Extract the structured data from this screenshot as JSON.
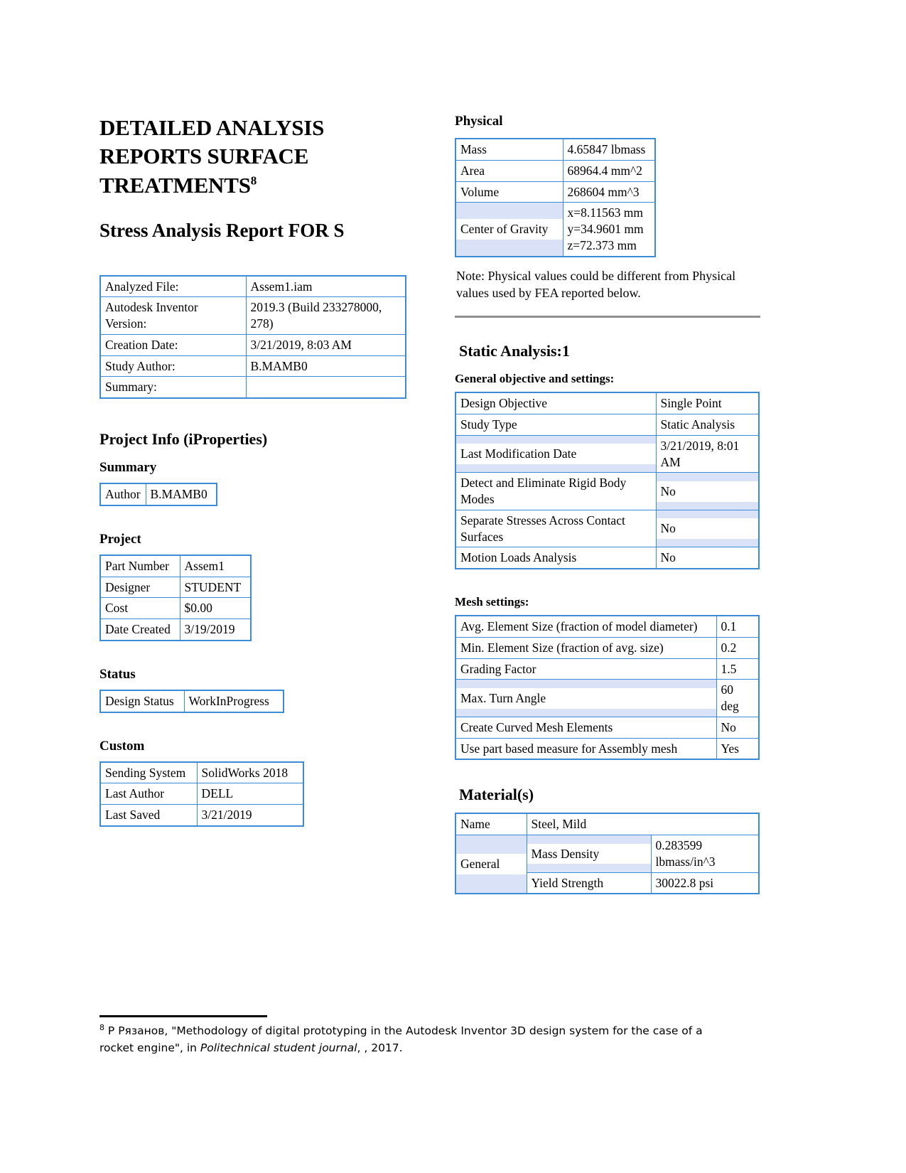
{
  "title": {
    "main": "DETAILED ANALYSIS REPORTS SURFACE TREATMENTS",
    "main_footnote_marker": "8",
    "sub": "Stress Analysis Report FOR S"
  },
  "colors": {
    "table_border": "#3a8bd8",
    "cell_fill": "#d9e2f7",
    "divider": "#909090"
  },
  "file_info": {
    "rows": [
      {
        "label": "Analyzed File:",
        "value": "Assem1.iam"
      },
      {
        "label": "Autodesk Inventor Version:",
        "value": "2019.3 (Build 233278000, 278)"
      },
      {
        "label": "Creation Date:",
        "value": "3/21/2019, 8:03 AM"
      },
      {
        "label": "Study Author:",
        "value": "B.MAMB0"
      },
      {
        "label": "Summary:",
        "value": ""
      }
    ]
  },
  "project_info": {
    "heading": "Project Info (iProperties)",
    "summary": {
      "heading": "Summary",
      "rows": [
        {
          "label": "Author",
          "value": "B.MAMB0"
        }
      ]
    },
    "project": {
      "heading": "Project",
      "rows": [
        {
          "label": "Part Number",
          "value": "Assem1"
        },
        {
          "label": "Designer",
          "value": "STUDENT"
        },
        {
          "label": "Cost",
          "value": "$0.00"
        },
        {
          "label": "Date Created",
          "value": "3/19/2019"
        }
      ]
    },
    "status": {
      "heading": "Status",
      "rows": [
        {
          "label": "Design Status",
          "value": "WorkInProgress"
        }
      ]
    },
    "custom": {
      "heading": "Custom",
      "rows": [
        {
          "label": "Sending System",
          "value": "SolidWorks 2018"
        },
        {
          "label": "Last Author",
          "value": "DELL"
        },
        {
          "label": "Last Saved",
          "value": "3/21/2019"
        }
      ]
    }
  },
  "physical": {
    "heading": "Physical",
    "rows": [
      {
        "label": "Mass",
        "value": "4.65847 lbmass"
      },
      {
        "label": "Area",
        "value": "68964.4 mm^2"
      },
      {
        "label": "Volume",
        "value": "268604 mm^3"
      },
      {
        "label": "Center of Gravity",
        "value": "x=8.11563 mm\ny=34.9601 mm\nz=72.373 mm"
      }
    ],
    "note": "Note: Physical values could be different from Physical values used by FEA reported below."
  },
  "static_analysis": {
    "heading": "Static Analysis:1",
    "general": {
      "heading": "General objective and settings:",
      "rows": [
        {
          "label": "Design Objective",
          "value": "Single Point"
        },
        {
          "label": "Study Type",
          "value": "Static Analysis"
        },
        {
          "label": "Last Modification Date",
          "value": "3/21/2019, 8:01 AM"
        },
        {
          "label": "Detect and Eliminate Rigid Body Modes",
          "value": "No"
        },
        {
          "label": "Separate Stresses Across Contact Surfaces",
          "value": "No"
        },
        {
          "label": "Motion Loads Analysis",
          "value": "No"
        }
      ]
    },
    "mesh": {
      "heading": "Mesh settings:",
      "rows": [
        {
          "label": "Avg. Element Size (fraction of model diameter)",
          "value": "0.1"
        },
        {
          "label": "Min. Element Size (fraction of avg. size)",
          "value": "0.2"
        },
        {
          "label": "Grading Factor",
          "value": "1.5"
        },
        {
          "label": "Max. Turn Angle",
          "value": "60 deg"
        },
        {
          "label": "Create Curved Mesh Elements",
          "value": "No"
        },
        {
          "label": "Use part based measure for Assembly mesh",
          "value": "Yes"
        }
      ]
    }
  },
  "materials": {
    "heading": "Material(s)",
    "name_label": "Name",
    "name_value": "Steel, Mild",
    "general_label": "General",
    "general_rows": [
      {
        "label": "Mass Density",
        "value": "0.283599 lbmass/in^3"
      },
      {
        "label": "Yield Strength",
        "value": "30022.8 psi"
      }
    ]
  },
  "footnote": {
    "marker": "8",
    "part1": " Р Рязанов, \"Methodology of digital prototyping in the Autodesk Inventor 3D design system for the case of a rocket engine\", in ",
    "italic": "Politechnical student journal",
    "part2": ", , 2017."
  }
}
